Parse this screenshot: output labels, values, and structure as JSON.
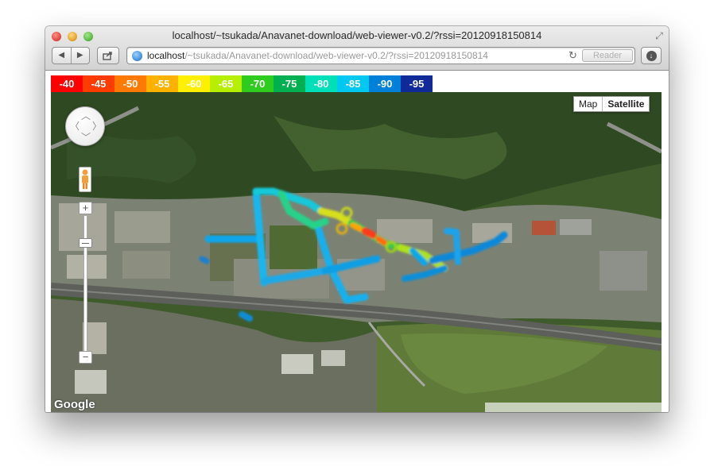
{
  "window": {
    "title": "localhost/~tsukada/Anavanet-download/web-viewer-v0.2/?rssi=20120918150814"
  },
  "toolbar": {
    "back_icon": "back-arrow-icon",
    "forward_icon": "forward-arrow-icon",
    "share_icon": "share-icon",
    "url_host": "localhost",
    "url_path": "/~tsukada/Anavanet-download/web-viewer-v0.2/?rssi=20120918150814",
    "reader_label": "Reader",
    "download_icon": "download-icon"
  },
  "legend": [
    {
      "label": "-40",
      "color": "#ff0000"
    },
    {
      "label": "-45",
      "color": "#ff3c00"
    },
    {
      "label": "-50",
      "color": "#ff7a00"
    },
    {
      "label": "-55",
      "color": "#ffb100"
    },
    {
      "label": "-60",
      "color": "#fff000"
    },
    {
      "label": "-65",
      "color": "#b6f000"
    },
    {
      "label": "-70",
      "color": "#2ecc1e"
    },
    {
      "label": "-75",
      "color": "#00b050"
    },
    {
      "label": "-80",
      "color": "#00e0b8"
    },
    {
      "label": "-85",
      "color": "#00c8f0"
    },
    {
      "label": "-90",
      "color": "#0080d8"
    },
    {
      "label": "-95",
      "color": "#102a9a"
    }
  ],
  "map": {
    "type_map_label": "Map",
    "type_satellite_label": "Satellite",
    "selected_type": "Satellite",
    "logo": "Google"
  }
}
